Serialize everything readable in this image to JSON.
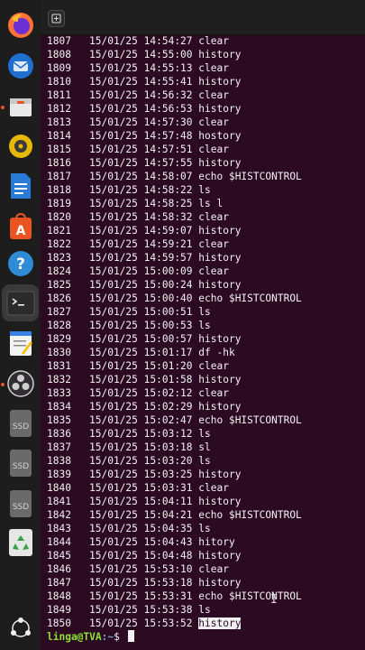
{
  "history": [
    {
      "num": "1807",
      "date": "15/01/25",
      "time": "14:54:27",
      "cmd": "clear"
    },
    {
      "num": "1808",
      "date": "15/01/25",
      "time": "14:55:00",
      "cmd": "history"
    },
    {
      "num": "1809",
      "date": "15/01/25",
      "time": "14:55:13",
      "cmd": "clear"
    },
    {
      "num": "1810",
      "date": "15/01/25",
      "time": "14:55:41",
      "cmd": "history"
    },
    {
      "num": "1811",
      "date": "15/01/25",
      "time": "14:56:32",
      "cmd": "clear"
    },
    {
      "num": "1812",
      "date": "15/01/25",
      "time": "14:56:53",
      "cmd": "history"
    },
    {
      "num": "1813",
      "date": "15/01/25",
      "time": "14:57:30",
      "cmd": "clear"
    },
    {
      "num": "1814",
      "date": "15/01/25",
      "time": "14:57:48",
      "cmd": "hostory"
    },
    {
      "num": "1815",
      "date": "15/01/25",
      "time": "14:57:51",
      "cmd": "clear"
    },
    {
      "num": "1816",
      "date": "15/01/25",
      "time": "14:57:55",
      "cmd": "history"
    },
    {
      "num": "1817",
      "date": "15/01/25",
      "time": "14:58:07",
      "cmd": "echo $HISTCONTROL"
    },
    {
      "num": "1818",
      "date": "15/01/25",
      "time": "14:58:22",
      "cmd": "ls"
    },
    {
      "num": "1819",
      "date": "15/01/25",
      "time": "14:58:25",
      "cmd": "ls l"
    },
    {
      "num": "1820",
      "date": "15/01/25",
      "time": "14:58:32",
      "cmd": "clear"
    },
    {
      "num": "1821",
      "date": "15/01/25",
      "time": "14:59:07",
      "cmd": "history"
    },
    {
      "num": "1822",
      "date": "15/01/25",
      "time": "14:59:21",
      "cmd": "clear"
    },
    {
      "num": "1823",
      "date": "15/01/25",
      "time": "14:59:57",
      "cmd": "history"
    },
    {
      "num": "1824",
      "date": "15/01/25",
      "time": "15:00:09",
      "cmd": "clear"
    },
    {
      "num": "1825",
      "date": "15/01/25",
      "time": "15:00:24",
      "cmd": "history"
    },
    {
      "num": "1826",
      "date": "15/01/25",
      "time": "15:00:40",
      "cmd": "echo $HISTCONTROL"
    },
    {
      "num": "1827",
      "date": "15/01/25",
      "time": "15:00:51",
      "cmd": "ls"
    },
    {
      "num": "1828",
      "date": "15/01/25",
      "time": "15:00:53",
      "cmd": "ls"
    },
    {
      "num": "1829",
      "date": "15/01/25",
      "time": "15:00:57",
      "cmd": "history"
    },
    {
      "num": "1830",
      "date": "15/01/25",
      "time": "15:01:17",
      "cmd": "df -hk"
    },
    {
      "num": "1831",
      "date": "15/01/25",
      "time": "15:01:20",
      "cmd": "clear"
    },
    {
      "num": "1832",
      "date": "15/01/25",
      "time": "15:01:58",
      "cmd": "history"
    },
    {
      "num": "1833",
      "date": "15/01/25",
      "time": "15:02:12",
      "cmd": "clear"
    },
    {
      "num": "1834",
      "date": "15/01/25",
      "time": "15:02:29",
      "cmd": "history"
    },
    {
      "num": "1835",
      "date": "15/01/25",
      "time": "15:02:47",
      "cmd": "echo $HISTCONTROL"
    },
    {
      "num": "1836",
      "date": "15/01/25",
      "time": "15:03:12",
      "cmd": "ls"
    },
    {
      "num": "1837",
      "date": "15/01/25",
      "time": "15:03:18",
      "cmd": "sl"
    },
    {
      "num": "1838",
      "date": "15/01/25",
      "time": "15:03:20",
      "cmd": "ls"
    },
    {
      "num": "1839",
      "date": "15/01/25",
      "time": "15:03:25",
      "cmd": "history"
    },
    {
      "num": "1840",
      "date": "15/01/25",
      "time": "15:03:31",
      "cmd": "clear"
    },
    {
      "num": "1841",
      "date": "15/01/25",
      "time": "15:04:11",
      "cmd": "history"
    },
    {
      "num": "1842",
      "date": "15/01/25",
      "time": "15:04:21",
      "cmd": "echo $HISTCONTROL"
    },
    {
      "num": "1843",
      "date": "15/01/25",
      "time": "15:04:35",
      "cmd": "ls"
    },
    {
      "num": "1844",
      "date": "15/01/25",
      "time": "15:04:43",
      "cmd": "hitory"
    },
    {
      "num": "1845",
      "date": "15/01/25",
      "time": "15:04:48",
      "cmd": "history"
    },
    {
      "num": "1846",
      "date": "15/01/25",
      "time": "15:53:10",
      "cmd": "clear"
    },
    {
      "num": "1847",
      "date": "15/01/25",
      "time": "15:53:18",
      "cmd": "history"
    },
    {
      "num": "1848",
      "date": "15/01/25",
      "time": "15:53:31",
      "cmd": "echo $HISTCONTROL"
    },
    {
      "num": "1849",
      "date": "15/01/25",
      "time": "15:53:38",
      "cmd": "ls"
    },
    {
      "num": "1850",
      "date": "15/01/25",
      "time": "15:53:52",
      "cmd": "history",
      "selected": true
    }
  ],
  "prompt": {
    "user_host": "linga@TVA",
    "path": ":~",
    "dollar": "$ "
  },
  "dock": [
    {
      "name": "firefox-icon"
    },
    {
      "name": "thunderbird-icon"
    },
    {
      "name": "files-icon"
    },
    {
      "name": "rhythmbox-icon"
    },
    {
      "name": "libreoffice-writer-icon"
    },
    {
      "name": "app-center-icon"
    },
    {
      "name": "help-icon"
    },
    {
      "name": "terminal-icon",
      "active": true
    },
    {
      "name": "text-editor-icon"
    },
    {
      "name": "obs-studio-icon"
    },
    {
      "name": "ssd-drive-icon",
      "label": "SSD"
    },
    {
      "name": "ssd-drive-icon",
      "label": "SSD"
    },
    {
      "name": "ssd-drive-icon",
      "label": "SSD"
    },
    {
      "name": "trash-icon"
    },
    {
      "name": "show-apps-icon"
    }
  ],
  "colors": {
    "terminal_bg": "#2c0a22",
    "prompt_user": "#8ae234",
    "prompt_path": "#729fcf",
    "dock_bg": "#1d1d1d"
  }
}
